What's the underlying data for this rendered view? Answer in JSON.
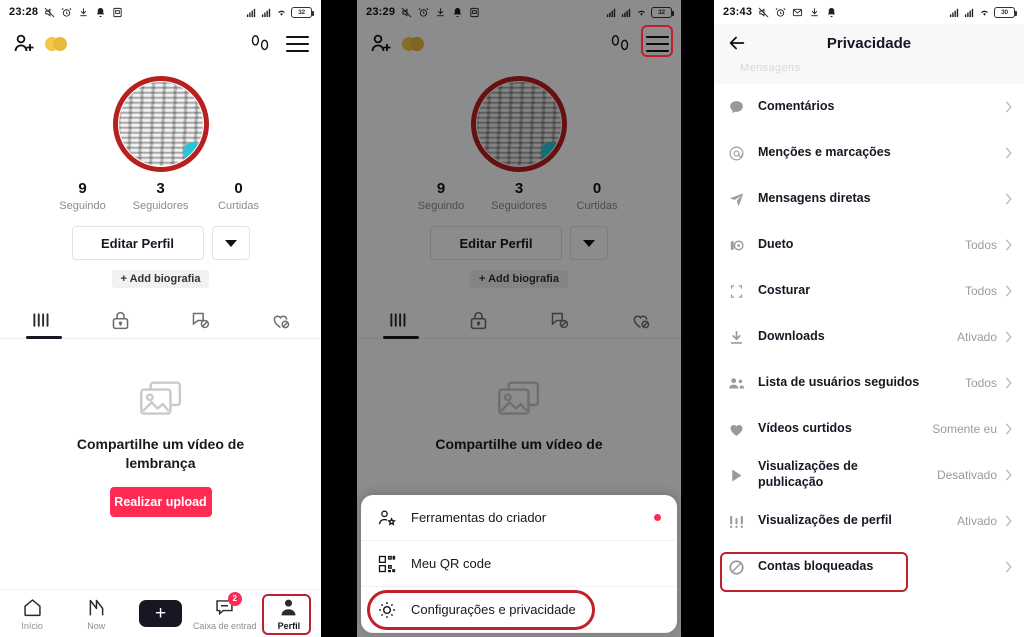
{
  "panel1": {
    "status": {
      "time": "23:28",
      "battery": "32",
      "left_icons": [
        "mute-icon",
        "alarm-icon",
        "download-icon",
        "bell-icon",
        "sim-icon"
      ],
      "right_icons": [
        "signal-icon",
        "signal-icon",
        "wifi-icon",
        "battery-icon"
      ]
    },
    "header": {
      "add_user_icon": "add-user-icon",
      "coin_icon": "coins-icon",
      "footprint_icon": "footprint-icon",
      "menu_icon": "hamburger-menu-icon"
    },
    "avatar": {
      "badge_icon": "status-badge-icon"
    },
    "stats": [
      {
        "num": "9",
        "label": "Seguindo"
      },
      {
        "num": "3",
        "label": "Seguidores"
      },
      {
        "num": "0",
        "label": "Curtidas"
      }
    ],
    "edit_profile": "Editar Perfil",
    "add_bio": "+ Add biografia",
    "tabs": [
      {
        "icon": "grid-posts-icon",
        "active": true
      },
      {
        "icon": "lock-private-icon",
        "active": false
      },
      {
        "icon": "repost-off-icon",
        "active": false
      },
      {
        "icon": "heart-off-icon",
        "active": false
      }
    ],
    "empty": {
      "icon": "photos-placeholder-icon",
      "text": "Compartilhe um vídeo de lembrança",
      "button": "Realizar upload"
    },
    "nav": [
      {
        "icon": "home-icon",
        "label": "Início",
        "active": false
      },
      {
        "icon": "now-icon",
        "label": "Now",
        "active": false
      },
      {
        "icon": "create-plus-icon",
        "label": "",
        "active": false
      },
      {
        "icon": "inbox-icon",
        "label": "Caixa de entrad",
        "badge": "2",
        "active": false
      },
      {
        "icon": "profile-person-icon",
        "label": "Perfil",
        "active": true
      }
    ]
  },
  "panel2": {
    "status": {
      "time": "23:29",
      "battery": "32"
    },
    "stats": [
      {
        "num": "9",
        "label": "Seguindo"
      },
      {
        "num": "3",
        "label": "Seguidores"
      },
      {
        "num": "0",
        "label": "Curtidas"
      }
    ],
    "edit_profile": "Editar Perfil",
    "add_bio": "+ Add biografia",
    "empty_text": "Compartilhe um vídeo de",
    "sheet": [
      {
        "icon": "creator-tools-icon",
        "label": "Ferramentas do criador",
        "dot": true
      },
      {
        "icon": "qr-code-icon",
        "label": "Meu QR code",
        "dot": false
      },
      {
        "icon": "gear-settings-icon",
        "label": "Configurações e privacidade",
        "dot": false
      }
    ]
  },
  "panel3": {
    "status": {
      "time": "23:43",
      "battery": "30"
    },
    "title": "Privacidade",
    "back_icon": "back-arrow-icon",
    "ghost_text": "Mensagens",
    "rows": [
      {
        "icon": "comment-icon",
        "label": "Comentários",
        "value": ""
      },
      {
        "icon": "mention-at-icon",
        "label": "Menções e marcações",
        "value": ""
      },
      {
        "icon": "direct-message-icon",
        "label": "Mensagens diretas",
        "value": ""
      },
      {
        "icon": "duet-icon",
        "label": "Dueto",
        "value": "Todos"
      },
      {
        "icon": "stitch-icon",
        "label": "Costurar",
        "value": "Todos"
      },
      {
        "icon": "download-icon",
        "label": "Downloads",
        "value": "Ativado"
      },
      {
        "icon": "following-list-icon",
        "label": "Lista de usuários seguidos",
        "value": "Todos"
      },
      {
        "icon": "heart-icon",
        "label": "Vídeos curtidos",
        "value": "Somente eu"
      },
      {
        "icon": "play-icon",
        "label": "Visualizações de publicação",
        "value": "Desativado"
      },
      {
        "icon": "profile-views-icon",
        "label": "Visualizações de perfil",
        "value": "Ativado"
      },
      {
        "icon": "blocked-icon",
        "label": "Contas bloqueadas",
        "value": ""
      }
    ]
  },
  "colors": {
    "accent": "#fe2c55",
    "highlight": "#c0202a",
    "cyan": "#25f4ee",
    "dark": "#161722"
  }
}
